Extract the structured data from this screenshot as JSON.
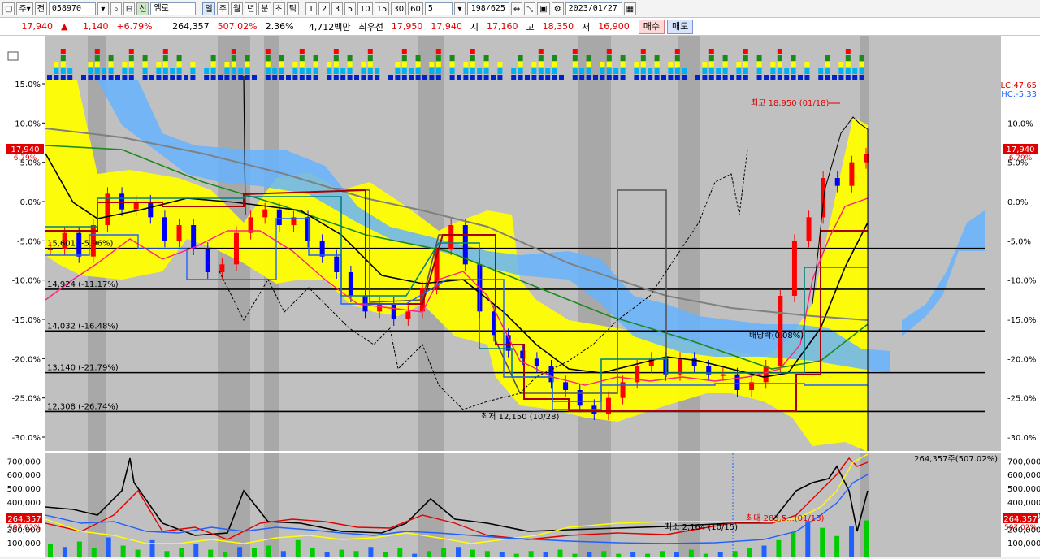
{
  "toolbar": {
    "period_label": "주",
    "code_prefix": "전",
    "stock_code": "058970",
    "search_icon": "search-icon",
    "sin_label": "신",
    "stock_name": "엠로",
    "period_buttons": [
      "일",
      "주",
      "월",
      "년",
      "분",
      "초",
      "틱"
    ],
    "active_period": "일",
    "number_buttons": [
      "1",
      "2",
      "3",
      "5",
      "10",
      "15",
      "30",
      "60"
    ],
    "interval_value": "5",
    "count_display": "198/625",
    "date_value": "2023/01/27"
  },
  "quote": {
    "price": "17,940",
    "change_arrow": "▲",
    "change": "1,140",
    "change_pct": "+6.79%",
    "volume": "264,357",
    "volume_ratio": "507.02%",
    "turnover": "2.36%",
    "amount": "4,712백만",
    "best_ask_label": "최우선",
    "best_ask": "17,950",
    "best_bid": "17,940",
    "open_label": "시",
    "open": "17,160",
    "high_label": "고",
    "high": "18,350",
    "low_label": "저",
    "low": "16,900",
    "buy_label": "매수",
    "sell_label": "매도"
  },
  "colors": {
    "ichimoku_cloud": "#ffff00",
    "kumo_blue": "#66b3ff",
    "up": "#ff0000",
    "down": "#0000ff",
    "background": "#c0c0c0",
    "shade": "#a8a8a8"
  },
  "chart_data": {
    "type": "line",
    "y_ticks": [
      "15.0%",
      "10.0%",
      "5.0%",
      "0.0%",
      "-5.0%",
      "-10.0%",
      "-15.0%",
      "-20.0%",
      "-25.0%",
      "-30.0%"
    ],
    "y_ticks_right": [
      "10.0%",
      "5.0%",
      "0.0%",
      "-5.0%",
      "-10.0%",
      "-15.0%",
      "-20.0%",
      "-25.0%",
      "-30.0%"
    ],
    "y_values": [
      15,
      10,
      5,
      0,
      -5,
      -10,
      -15,
      -20,
      -25,
      -30
    ],
    "ylim": [
      -32,
      16
    ],
    "current_price_tag": "17,940",
    "current_pct_tag": "6.79%",
    "lc_label": "LC:47.65",
    "hc_label": "HC:-5.33",
    "fib_levels": [
      {
        "label": "15,601 (-5.96%)",
        "pct": -5.96
      },
      {
        "label": "14,924 (-11.17%)",
        "pct": -11.17
      },
      {
        "label": "14,032 (-16.48%)",
        "pct": -16.48
      },
      {
        "label": "13,140 (-21.79%)",
        "pct": -21.79
      },
      {
        "label": "12,308 (-26.74%)",
        "pct": -26.74
      }
    ],
    "annotations": {
      "high": "최고 18,950 (01/18)",
      "low": "최저 12,150 (10/28)",
      "dividend": "배당락(0.08%)",
      "volume_high": "최대 283,5...(01/18)",
      "volume_low": "최소 2,164 (10/15)"
    },
    "volume_ticks": [
      "700,000",
      "600,000",
      "500,000",
      "400,000",
      "300,000",
      "200,000",
      "100,000"
    ],
    "volume_values": [
      700000,
      600000,
      500000,
      400000,
      300000,
      200000,
      100000
    ],
    "volume_ylim": [
      0,
      720000
    ],
    "volume_header": "264,357주(507.02%)",
    "volume_tag": "264,357",
    "volume_pct_tag": "507.02%",
    "price_series": [
      -6,
      -4,
      -7,
      -3,
      1,
      -1,
      0,
      -2,
      -5,
      -3,
      -6,
      -9,
      -8,
      -4,
      -2,
      -1,
      -3,
      -2,
      -5,
      -7,
      -9,
      -12,
      -14,
      -13,
      -15,
      -14,
      -11,
      -6,
      -3,
      -8,
      -14,
      -17,
      -19,
      -20,
      -21,
      -23,
      -24,
      -26,
      -27,
      -25,
      -23,
      -21,
      -20,
      -22,
      -20,
      -21,
      -22,
      -22,
      -24,
      -23,
      -21,
      -12,
      -5,
      -2,
      3,
      2,
      5,
      6
    ],
    "volume_series": [
      90000,
      70000,
      110000,
      60000,
      140000,
      80000,
      50000,
      120000,
      40000,
      60000,
      90000,
      50000,
      30000,
      70000,
      60000,
      80000,
      40000,
      120000,
      60000,
      30000,
      50000,
      40000,
      70000,
      30000,
      60000,
      20000,
      40000,
      60000,
      70000,
      50000,
      40000,
      30000,
      20000,
      40000,
      30000,
      50000,
      20000,
      30000,
      40000,
      20000,
      30000,
      20000,
      40000,
      30000,
      50000,
      20000,
      30000,
      40000,
      60000,
      80000,
      120000,
      180000,
      260000,
      210000,
      150000,
      220000,
      264357
    ]
  }
}
